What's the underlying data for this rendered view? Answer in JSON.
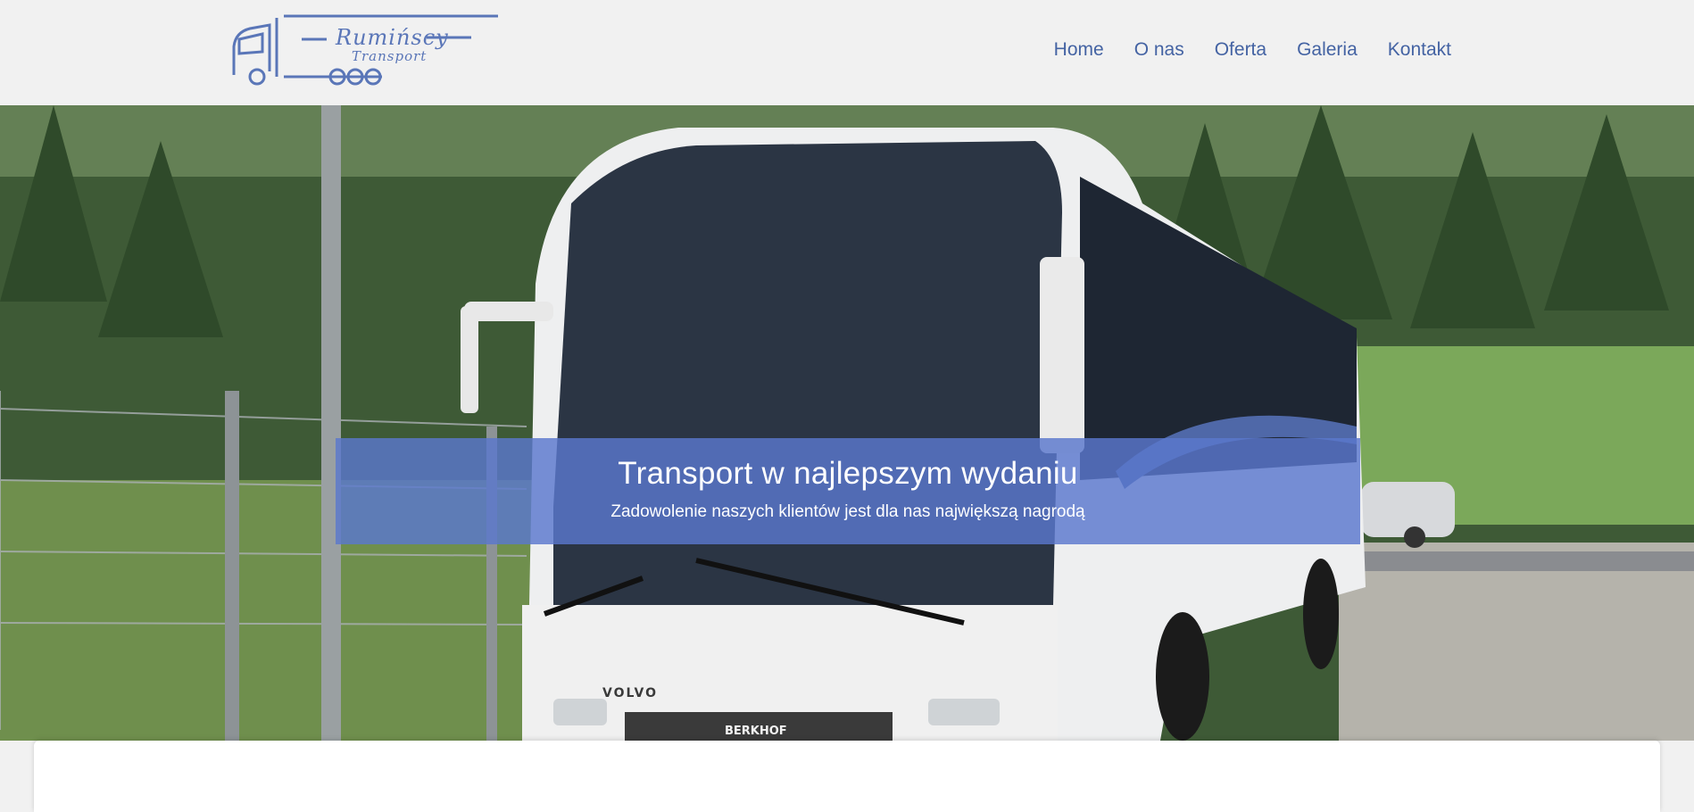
{
  "header": {
    "logo": {
      "text_main": "Rumińscy",
      "text_sub": "Transport"
    },
    "nav": [
      {
        "label": "Home"
      },
      {
        "label": "O nas"
      },
      {
        "label": "Oferta"
      },
      {
        "label": "Galeria"
      },
      {
        "label": "Kontakt"
      }
    ]
  },
  "hero": {
    "title": "Transport w najlepszym wydaniu",
    "subtitle": "Zadowolenie naszych klientów jest dla nas największą nagrodą",
    "image_desc": "white-coach-bus-photo",
    "bus_brand": "VOLVO",
    "bus_grille_text": "BERKHOF"
  },
  "colors": {
    "accent": "#4463a3",
    "caption_bg": "#5a78cd",
    "header_bg": "#f1f1f1"
  }
}
